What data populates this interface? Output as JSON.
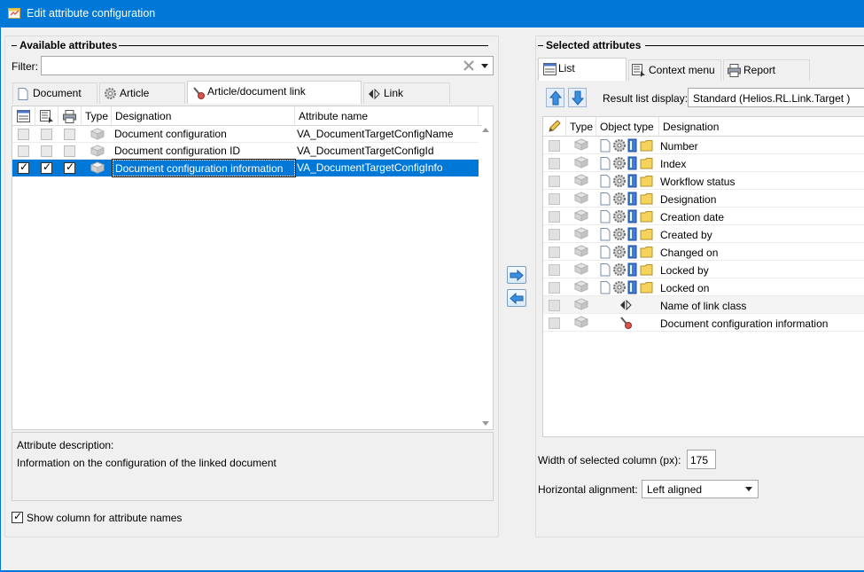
{
  "window": {
    "title": "Edit attribute configuration"
  },
  "available": {
    "title": "Available attributes",
    "filter_label": "Filter:",
    "filter_value": "",
    "tabs": [
      {
        "label": "Document",
        "icon": "document-icon"
      },
      {
        "label": "Article",
        "icon": "gear-icon"
      },
      {
        "label": "Article/document link",
        "icon": "link-pin-icon",
        "active": true
      },
      {
        "label": "Link",
        "icon": "link-arrows-icon"
      }
    ],
    "columns": {
      "type": "Type",
      "designation": "Designation",
      "attribute_name": "Attribute name"
    },
    "rows": [
      {
        "c1": false,
        "c2": false,
        "c3": false,
        "designation": "Document configuration",
        "attribute_name": "VA_DocumentTargetConfigName",
        "selected": false
      },
      {
        "c1": false,
        "c2": false,
        "c3": false,
        "designation": "Document configuration ID",
        "attribute_name": "VA_DocumentTargetConfigId",
        "selected": false
      },
      {
        "c1": true,
        "c2": true,
        "c3": true,
        "designation": "Document configuration information",
        "attribute_name": "VA_DocumentTargetConfigInfo",
        "selected": true
      }
    ],
    "description_label": "Attribute description:",
    "description_text": "Information on the configuration of the linked document",
    "show_column_label": "Show column for attribute names",
    "show_column_checked": true
  },
  "selected": {
    "title": "Selected attributes",
    "tabs": [
      {
        "label": "List",
        "icon": "list-icon",
        "active": true
      },
      {
        "label": "Context menu",
        "icon": "context-menu-icon"
      },
      {
        "label": "Report",
        "icon": "printer-icon"
      }
    ],
    "result_list_label": "Result list display:",
    "result_list_value": "Standard (Helios.RL.Link.Target )",
    "columns": {
      "type": "Type",
      "object_type": "Object type",
      "designation": "Designation"
    },
    "rows": [
      {
        "designation": "Number",
        "objtype": "multi"
      },
      {
        "designation": "Index",
        "objtype": "multi"
      },
      {
        "designation": "Workflow status",
        "objtype": "multi"
      },
      {
        "designation": "Designation",
        "objtype": "multi"
      },
      {
        "designation": "Creation date",
        "objtype": "multi"
      },
      {
        "designation": "Created by",
        "objtype": "multi"
      },
      {
        "designation": "Changed on",
        "objtype": "multi"
      },
      {
        "designation": "Locked by",
        "objtype": "multi"
      },
      {
        "designation": "Locked on",
        "objtype": "multi"
      },
      {
        "designation": "Name of link class",
        "objtype": "link"
      },
      {
        "designation": "Document configuration information",
        "objtype": "pin"
      }
    ],
    "width_label": "Width of selected column (px):",
    "width_value": "175",
    "alignment_label": "Horizontal alignment:",
    "alignment_value": "Left aligned"
  }
}
